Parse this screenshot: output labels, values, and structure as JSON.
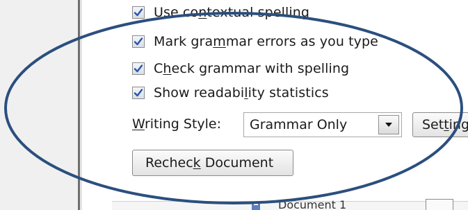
{
  "options": {
    "contextual_spelling": {
      "label_pre": "Use co",
      "label_key": "n",
      "label_post": "textual spelling",
      "checked": true
    },
    "mark_grammar": {
      "label_pre": "Mark gra",
      "label_key": "m",
      "label_post": "mar errors as you type",
      "checked": true
    },
    "check_grammar": {
      "label_pre": "C",
      "label_key": "h",
      "label_post": "eck grammar with spelling",
      "checked": true
    },
    "readability": {
      "label_pre": "Show readabi",
      "label_key": "l",
      "label_post": "ity statistics",
      "checked": true
    }
  },
  "writing_style": {
    "label_key": "W",
    "label_post": "riting Style:",
    "selected": "Grammar Only"
  },
  "buttons": {
    "settings_pre": "Set",
    "settings_key": "t",
    "settings_post": "ings...",
    "recheck_pre": "Rechec",
    "recheck_key": "k",
    "recheck_post": " Document"
  },
  "bottom": {
    "partial_text": "Document 1"
  },
  "colors": {
    "check_mark": "#2a55a8",
    "annotation_ellipse": "#2b4f7e"
  }
}
